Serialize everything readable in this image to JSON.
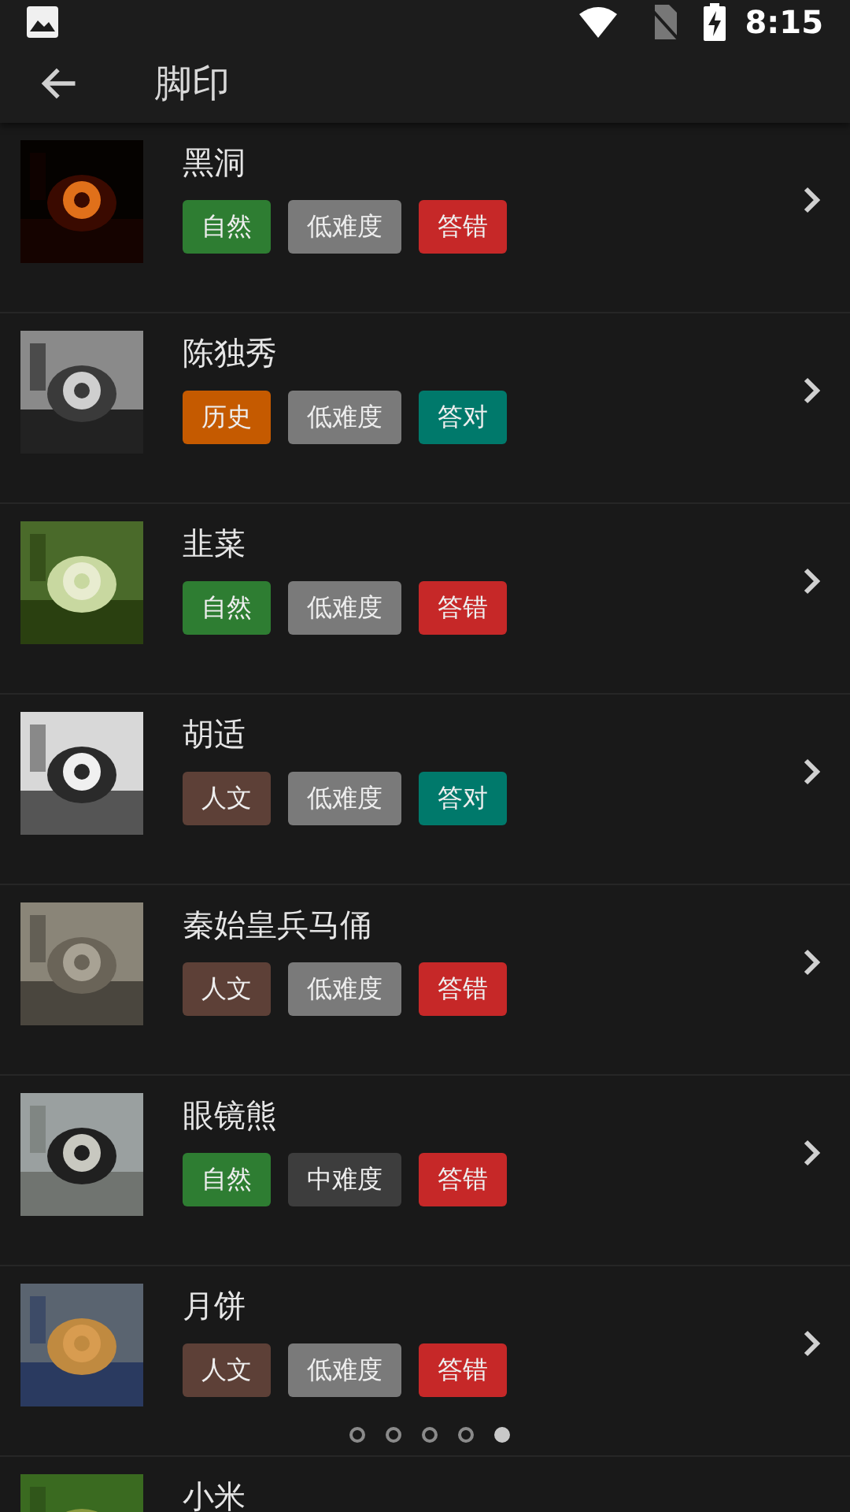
{
  "status_bar": {
    "time": "8:15"
  },
  "app_bar": {
    "title": "脚印"
  },
  "items": [
    {
      "title": "黑洞",
      "tags": [
        {
          "label": "自然",
          "color": "#2e7d32"
        },
        {
          "label": "低难度",
          "color": "#7a7a7a"
        },
        {
          "label": "答错",
          "color": "#c62828"
        }
      ]
    },
    {
      "title": "陈独秀",
      "tags": [
        {
          "label": "历史",
          "color": "#c55a00"
        },
        {
          "label": "低难度",
          "color": "#7a7a7a"
        },
        {
          "label": "答对",
          "color": "#00796b"
        }
      ]
    },
    {
      "title": "韭菜",
      "tags": [
        {
          "label": "自然",
          "color": "#2e7d32"
        },
        {
          "label": "低难度",
          "color": "#7a7a7a"
        },
        {
          "label": "答错",
          "color": "#c62828"
        }
      ]
    },
    {
      "title": "胡适",
      "tags": [
        {
          "label": "人文",
          "color": "#5d4037"
        },
        {
          "label": "低难度",
          "color": "#7a7a7a"
        },
        {
          "label": "答对",
          "color": "#00796b"
        }
      ]
    },
    {
      "title": "秦始皇兵马俑",
      "tags": [
        {
          "label": "人文",
          "color": "#5d4037"
        },
        {
          "label": "低难度",
          "color": "#7a7a7a"
        },
        {
          "label": "答错",
          "color": "#c62828"
        }
      ]
    },
    {
      "title": "眼镜熊",
      "tags": [
        {
          "label": "自然",
          "color": "#2e7d32"
        },
        {
          "label": "中难度",
          "color": "#3d3d3d"
        },
        {
          "label": "答错",
          "color": "#c62828"
        }
      ]
    },
    {
      "title": "月饼",
      "tags": [
        {
          "label": "人文",
          "color": "#5d4037"
        },
        {
          "label": "低难度",
          "color": "#7a7a7a"
        },
        {
          "label": "答错",
          "color": "#c62828"
        }
      ]
    },
    {
      "title": "小米"
    }
  ],
  "pager": [
    {
      "selected": false
    },
    {
      "selected": false
    },
    {
      "selected": false
    },
    {
      "selected": false
    },
    {
      "selected": true
    }
  ]
}
